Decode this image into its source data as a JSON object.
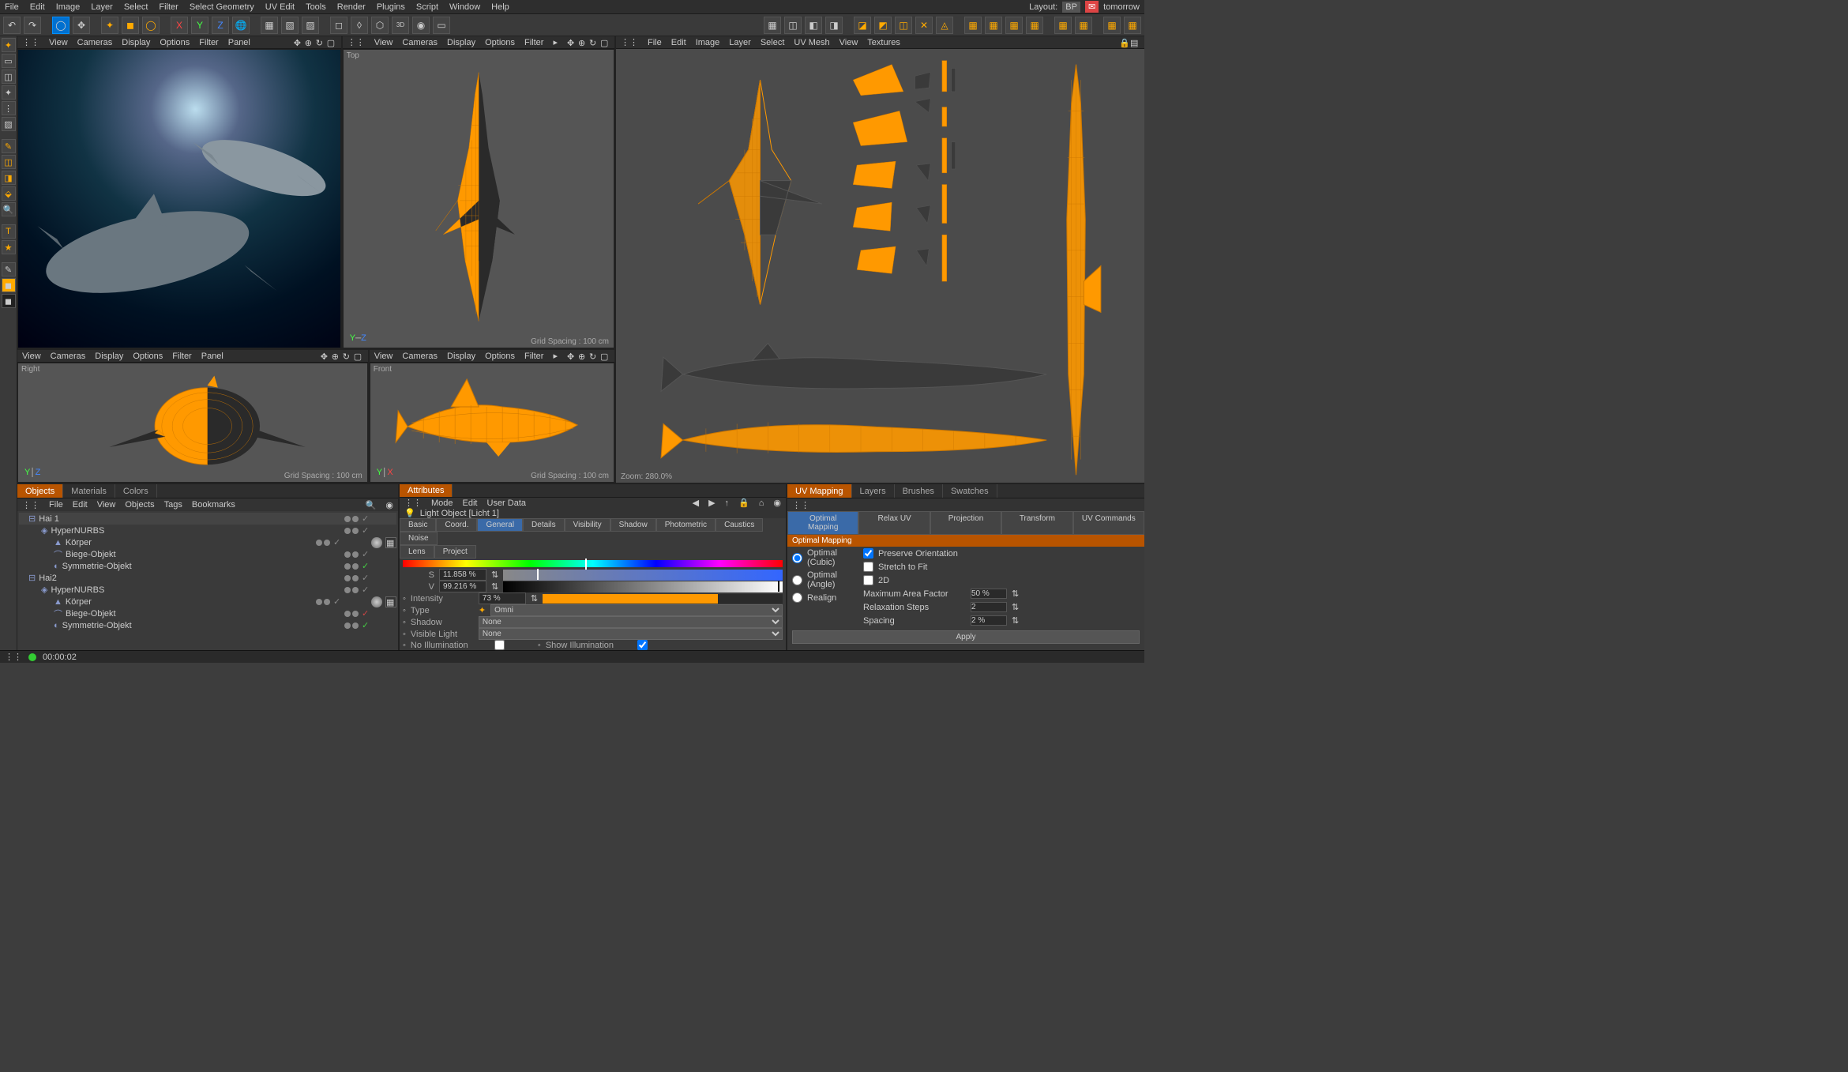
{
  "menu": {
    "items": [
      "File",
      "Edit",
      "Image",
      "Layer",
      "Select",
      "Filter",
      "Select Geometry",
      "UV Edit",
      "Tools",
      "Render",
      "Plugins",
      "Script",
      "Window",
      "Help"
    ],
    "layout_label": "Layout:",
    "layout_value": "BP"
  },
  "notif": "tomorrow",
  "viewport_menu": {
    "items": [
      "View",
      "Cameras",
      "Display",
      "Options",
      "Filter",
      "Panel"
    ]
  },
  "viewport_menu_short": {
    "items": [
      "View",
      "Cameras",
      "Display",
      "Options",
      "Filter"
    ]
  },
  "uv_menu": {
    "items": [
      "File",
      "Edit",
      "Image",
      "Layer",
      "Select",
      "UV Mesh",
      "View",
      "Textures"
    ]
  },
  "vp": {
    "top_label": "Top",
    "right_label": "Right",
    "front_label": "Front",
    "grid_spacing": "Grid Spacing : 100 cm",
    "uv_zoom": "Zoom: 280.0%"
  },
  "objects_panel": {
    "tabs": [
      "Objects",
      "Materials",
      "Colors"
    ],
    "menu": [
      "File",
      "Edit",
      "View",
      "Objects",
      "Tags",
      "Bookmarks"
    ],
    "tree": [
      {
        "ind": 0,
        "icon": "expand",
        "name": "Hai 1",
        "sel": true
      },
      {
        "ind": 1,
        "icon": "hn",
        "name": "HyperNURBS"
      },
      {
        "ind": 2,
        "icon": "poly",
        "name": "Körper",
        "tags": true
      },
      {
        "ind": 2,
        "icon": "bend",
        "name": "Biege-Objekt"
      },
      {
        "ind": 2,
        "icon": "sym",
        "name": "Symmetrie-Objekt",
        "green": true
      },
      {
        "ind": 0,
        "icon": "expand",
        "name": "Hai2"
      },
      {
        "ind": 1,
        "icon": "hn",
        "name": "HyperNURBS"
      },
      {
        "ind": 2,
        "icon": "poly",
        "name": "Körper",
        "tags": true
      },
      {
        "ind": 2,
        "icon": "bend",
        "name": "Biege-Objekt",
        "red": true
      },
      {
        "ind": 2,
        "icon": "sym",
        "name": "Symmetrie-Objekt",
        "green": true
      }
    ]
  },
  "attributes_panel": {
    "tab": "Attributes",
    "menu": [
      "Mode",
      "Edit",
      "User Data"
    ],
    "object_label": "Light Object [Licht 1]",
    "tabs_row1": [
      "Basic",
      "Coord.",
      "General",
      "Details",
      "Visibility",
      "Shadow",
      "Photometric",
      "Caustics",
      "Noise"
    ],
    "tabs_row2": [
      "Lens",
      "Project"
    ],
    "active_tab": "General",
    "fields": {
      "s_label": "S",
      "s_value": "11.858 %",
      "v_label": "V",
      "v_value": "99.216 %",
      "intensity_label": "Intensity",
      "intensity_value": "73 %",
      "intensity_pct": 73,
      "type_label": "Type",
      "type_value": "Omni",
      "shadow_label": "Shadow",
      "shadow_value": "None",
      "visible_label": "Visible Light",
      "visible_value": "None",
      "noillum_label": "No Illumination",
      "showillum_label": "Show Illumination"
    }
  },
  "uv_panel": {
    "tabs": [
      "UV Mapping",
      "Layers",
      "Brushes",
      "Swatches"
    ],
    "cmd_tabs": [
      "Optimal Mapping",
      "Relax UV",
      "Projection",
      "Transform",
      "UV Commands"
    ],
    "section": "Optimal Mapping",
    "radios": [
      "Optimal (Cubic)",
      "Optimal (Angle)",
      "Realign"
    ],
    "checks": {
      "preserve": "Preserve Orientation",
      "stretch": "Stretch to Fit",
      "twod": "2D"
    },
    "max_area_label": "Maximum Area Factor",
    "max_area_value": "50 %",
    "relax_label": "Relaxation Steps",
    "relax_value": "2",
    "spacing_label": "Spacing",
    "spacing_value": "2 %",
    "apply": "Apply"
  },
  "status": {
    "time": "00:00:02"
  }
}
